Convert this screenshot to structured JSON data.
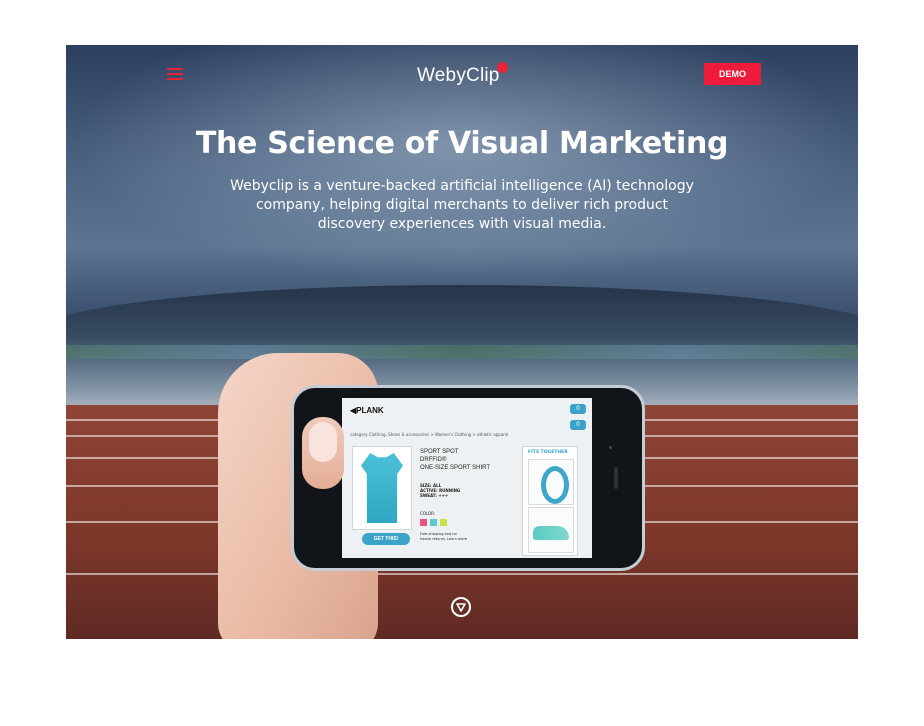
{
  "header": {
    "logo_text": "WebyClip",
    "demo_label": "DEMO"
  },
  "hero": {
    "title": "The Science of Visual Marketing",
    "subtitle": "Webyclip is a venture-backed artificial intelligence (AI) technology company, helping digital merchants to deliver rich product discovery experiences with visual media."
  },
  "phone_screen": {
    "brand": "PLANK",
    "side_badges": [
      "0",
      "0"
    ],
    "breadcrumb": "category  Clothing, Shoes & accessories > Women's Clothing > athletic apparel",
    "product_title_lines": [
      "SPORT SPOT",
      "DRFFID®",
      "ONE-SIZE SPORT SHIRT"
    ],
    "meta_lines": [
      "SIZE: ALL",
      "ACTIVE: RUNNING",
      "SWEAT: +++"
    ],
    "color_label": "COLOR:",
    "shipping_lines": [
      "Free shipping and no",
      "hassle returns. Learn more"
    ],
    "get_button": "GET THIS!",
    "fits_label": "FITS TOGETHER"
  },
  "colors": {
    "accent": "#ee1c3a",
    "screen_accent": "#3aa3c7",
    "swatches": [
      "#e8567f",
      "#5cc8d0",
      "#c8e04a"
    ]
  },
  "icons": {
    "menu": "hamburger-icon",
    "scroll": "chevron-down-circle-icon"
  }
}
